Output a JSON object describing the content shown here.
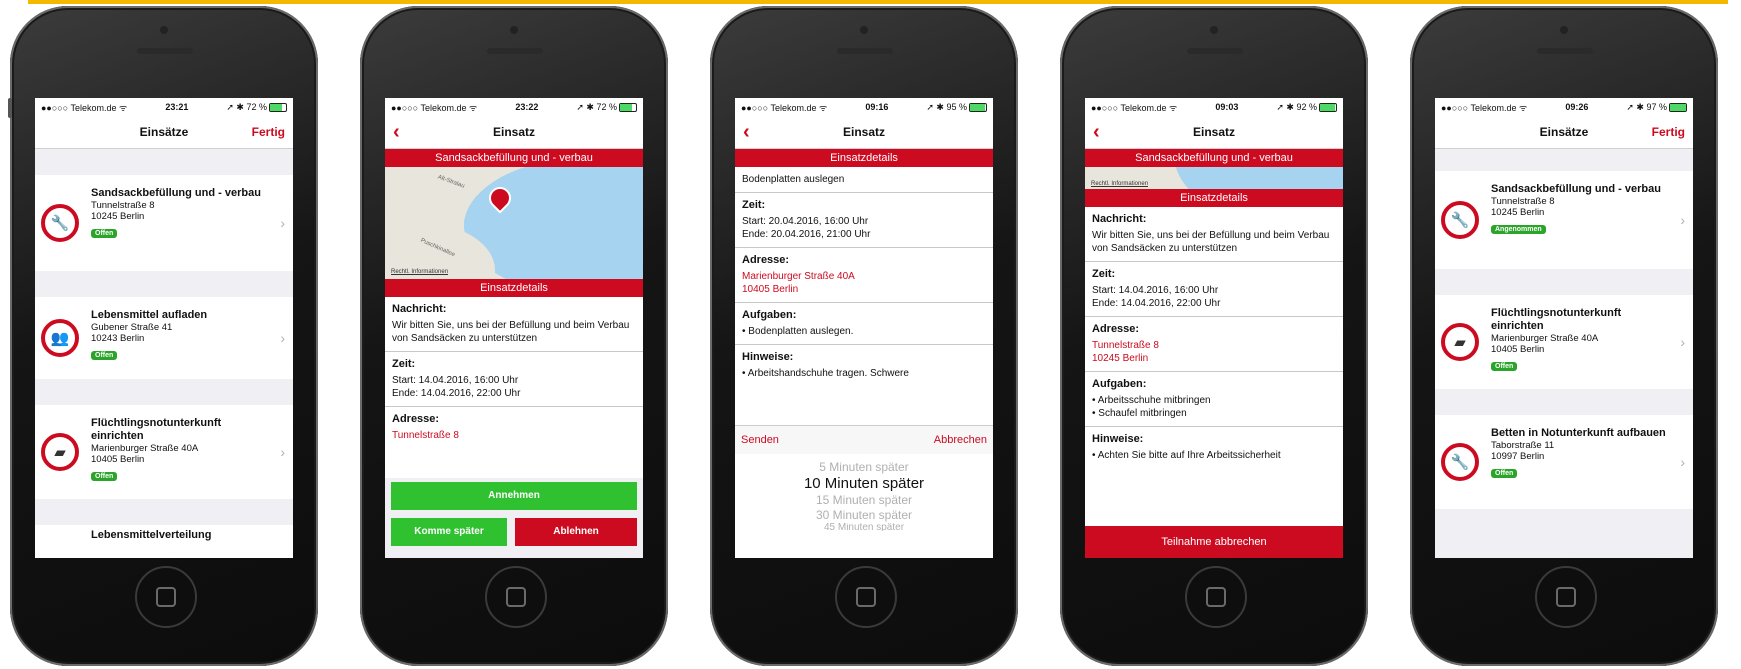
{
  "status": {
    "carrier": "●●○○○ Telekom.de ᯤ",
    "screens": [
      {
        "time": "23:21",
        "battery": "➚ ✱ 72 %",
        "level": 0.72
      },
      {
        "time": "23:22",
        "battery": "➚ ✱ 72 %",
        "level": 0.72
      },
      {
        "time": "09:16",
        "battery": "➚ ✱ 95 %",
        "level": 0.95
      },
      {
        "time": "09:03",
        "battery": "➚ ✱ 92 %",
        "level": 0.92
      },
      {
        "time": "09:26",
        "battery": "➚ ✱ 97 %",
        "level": 0.97
      }
    ]
  },
  "colors": {
    "accent": "#cc0b20",
    "badge": "#2aa52a",
    "button_green": "#2fc12f"
  },
  "screen1": {
    "title": "Einsätze",
    "right": "Fertig",
    "items": [
      {
        "icon": "wrench-icon",
        "title": "Sandsackbefüllung und - verbau",
        "street": "Tunnelstraße 8",
        "city": "10245 Berlin",
        "badge": "Offen"
      },
      {
        "icon": "people-icon",
        "title": "Lebensmittel aufladen",
        "street": "Gubener Straße 41",
        "city": "10243 Berlin",
        "badge": "Offen"
      },
      {
        "icon": "bed-icon",
        "title": "Flüchtlingsnotunterkunft einrichten",
        "street": "Marienburger Straße 40A",
        "city": "10405 Berlin",
        "badge": "Offen"
      }
    ],
    "partial": "Lebensmittelverteilung"
  },
  "screen2": {
    "title": "Einsatz",
    "banner": "Sandsackbefüllung und - verbau",
    "map_legal": "Rechtl. Informationen",
    "map_street1": "Alt-Stralau",
    "map_street2": "Puschkinallee",
    "details": "Einsatzdetails",
    "msg_h": "Nachricht:",
    "msg": "Wir bitten Sie, uns bei der Befüllung und beim Verbau von Sandsäcken zu unterstützen",
    "time_h": "Zeit:",
    "start": "Start: 14.04.2016, 16:00 Uhr",
    "end": "Ende: 14.04.2016, 22:00 Uhr",
    "addr_h": "Adresse:",
    "addr": "Tunnelstraße 8",
    "accept": "Annehmen",
    "later": "Komme später",
    "decline": "Ablehnen"
  },
  "screen3": {
    "title": "Einsatz",
    "details": "Einsatzdetails",
    "task_line": "Bodenplatten auslegen",
    "time_h": "Zeit:",
    "start": "Start: 20.04.2016, 16:00 Uhr",
    "end": "Ende: 20.04.2016, 21:00 Uhr",
    "addr_h": "Adresse:",
    "addr1": "Marienburger Straße 40A",
    "addr2": "10405 Berlin",
    "tasks_h": "Aufgaben:",
    "tasks": "• Bodenplatten auslegen.",
    "notes_h": "Hinweise:",
    "notes": "• Arbeitshandschuhe tragen. Schwere",
    "send": "Senden",
    "cancel": "Abbrechen",
    "options": [
      "5 Minuten später",
      "10 Minuten später",
      "15 Minuten später",
      "30 Minuten später",
      "45 Minuten später"
    ]
  },
  "screen4": {
    "title": "Einsatz",
    "banner": "Sandsackbefüllung und - verbau",
    "map_legal": "Rechtl. Informationen",
    "details": "Einsatzdetails",
    "msg_h": "Nachricht:",
    "msg": "Wir bitten Sie, uns bei der Befüllung und beim Verbau von Sandsäcken zu unterstützen",
    "time_h": "Zeit:",
    "start": "Start: 14.04.2016, 16:00 Uhr",
    "end": "Ende: 14.04.2016, 22:00 Uhr",
    "addr_h": "Adresse:",
    "addr1": "Tunnelstraße 8",
    "addr2": "10245 Berlin",
    "tasks_h": "Aufgaben:",
    "task1": "• Arbeitsschuhe mitbringen",
    "task2": "• Schaufel mitbringen",
    "notes_h": "Hinweise:",
    "notes": "• Achten Sie bitte auf Ihre Arbeitssicherheit",
    "cancel": "Teilnahme abbrechen"
  },
  "screen5": {
    "title": "Einsätze",
    "right": "Fertig",
    "items": [
      {
        "icon": "wrench-icon",
        "title": "Sandsackbefüllung und - verbau",
        "street": "Tunnelstraße 8",
        "city": "10245 Berlin",
        "badge": "Angenommen"
      },
      {
        "icon": "bed-icon",
        "title": "Flüchtlingsnotunterkunft einrichten",
        "street": "Marienburger Straße 40A",
        "city": "10405 Berlin",
        "badge": "Offen"
      },
      {
        "icon": "wrench-icon",
        "title": "Betten in Notunterkunft aufbauen",
        "street": "Taborstraße 11",
        "city": "10997 Berlin",
        "badge": "Offen"
      }
    ]
  }
}
